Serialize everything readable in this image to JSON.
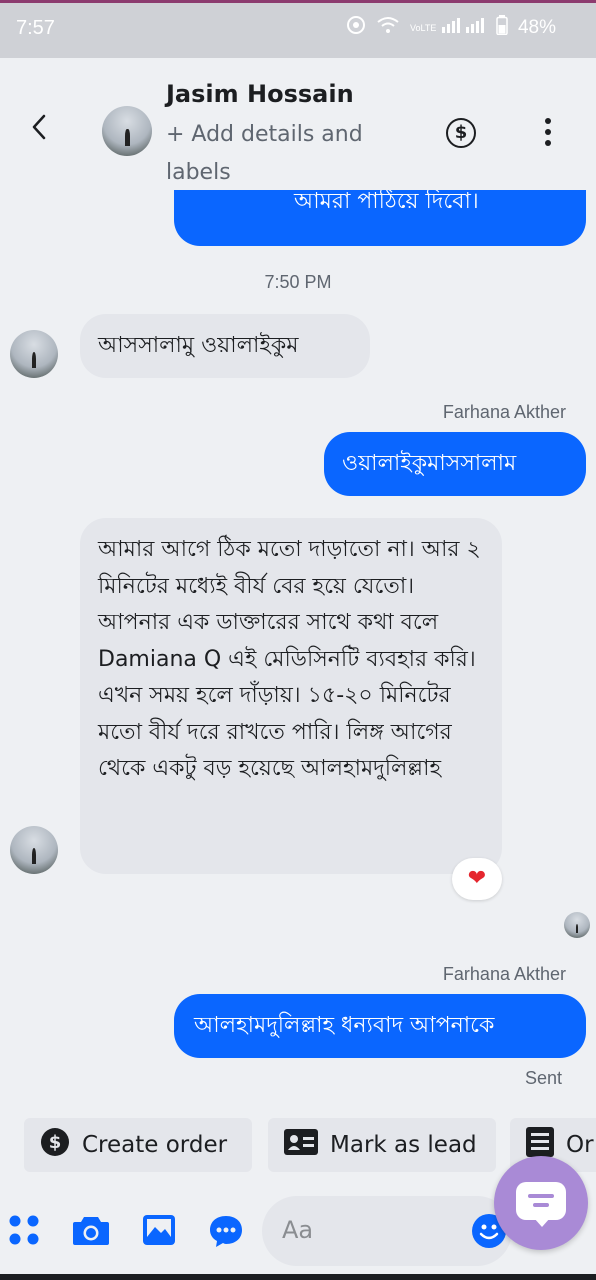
{
  "status_bar": {
    "time": "7:57",
    "network_label": "VoLTE",
    "battery": "48%"
  },
  "header": {
    "contact_name": "Jasim Hossain",
    "subtitle": "+ Add details and labels"
  },
  "messages": {
    "top_partial": "আমরা পাঠিয়ে দিবো।",
    "timestamp": "7:50 PM",
    "incoming_1": "আসসালামু ওয়ালাইকুম",
    "sender_1": "Farhana Akther",
    "outgoing_1": "ওয়ালাইকুমাসসালাম",
    "incoming_2": "আমার আগে ঠিক মতো দাড়াতো না। আর ২ মিনিটের মধ্যেই বীর্য বের হয়ে যেতো। আপনার এক ডাক্তারের সাথে কথা বলে Damiana Q এই মেডিসিনটি ব্যবহার করি। এখন সময় হলে দাঁড়ায়। ১৫-২০ মিনিটের মতো বীর্য দরে রাখতে পারি। লিঙ্গ আগের থেকে একটু  বড় হয়েছে আলহামদুলিল্লাহ",
    "reaction": "❤",
    "sender_2": "Farhana Akther",
    "outgoing_2": "আলহামদুলিল্লাহ ধন্যবাদ আপনাকে",
    "delivery_status": "Sent"
  },
  "quick_actions": {
    "create_order": "Create order",
    "mark_as_lead": "Mark as lead",
    "more_partial": "Or"
  },
  "composer": {
    "placeholder": "Aa"
  },
  "colors": {
    "accent_blue": "#0a66ff",
    "incoming_bubble": "#e4e6eb",
    "background": "#eef0f3",
    "fab_purple": "#a98ad6",
    "heart_red": "#e5262e"
  },
  "icons": {
    "back": "chevron-left-icon",
    "payment": "dollar-circle-icon",
    "menu": "kebab-menu-icon",
    "apps": "apps-grid-icon",
    "camera": "camera-icon",
    "gallery": "image-icon",
    "saved_replies": "chat-bubble-icon",
    "emoji": "smiley-icon",
    "fab": "message-card-icon"
  }
}
